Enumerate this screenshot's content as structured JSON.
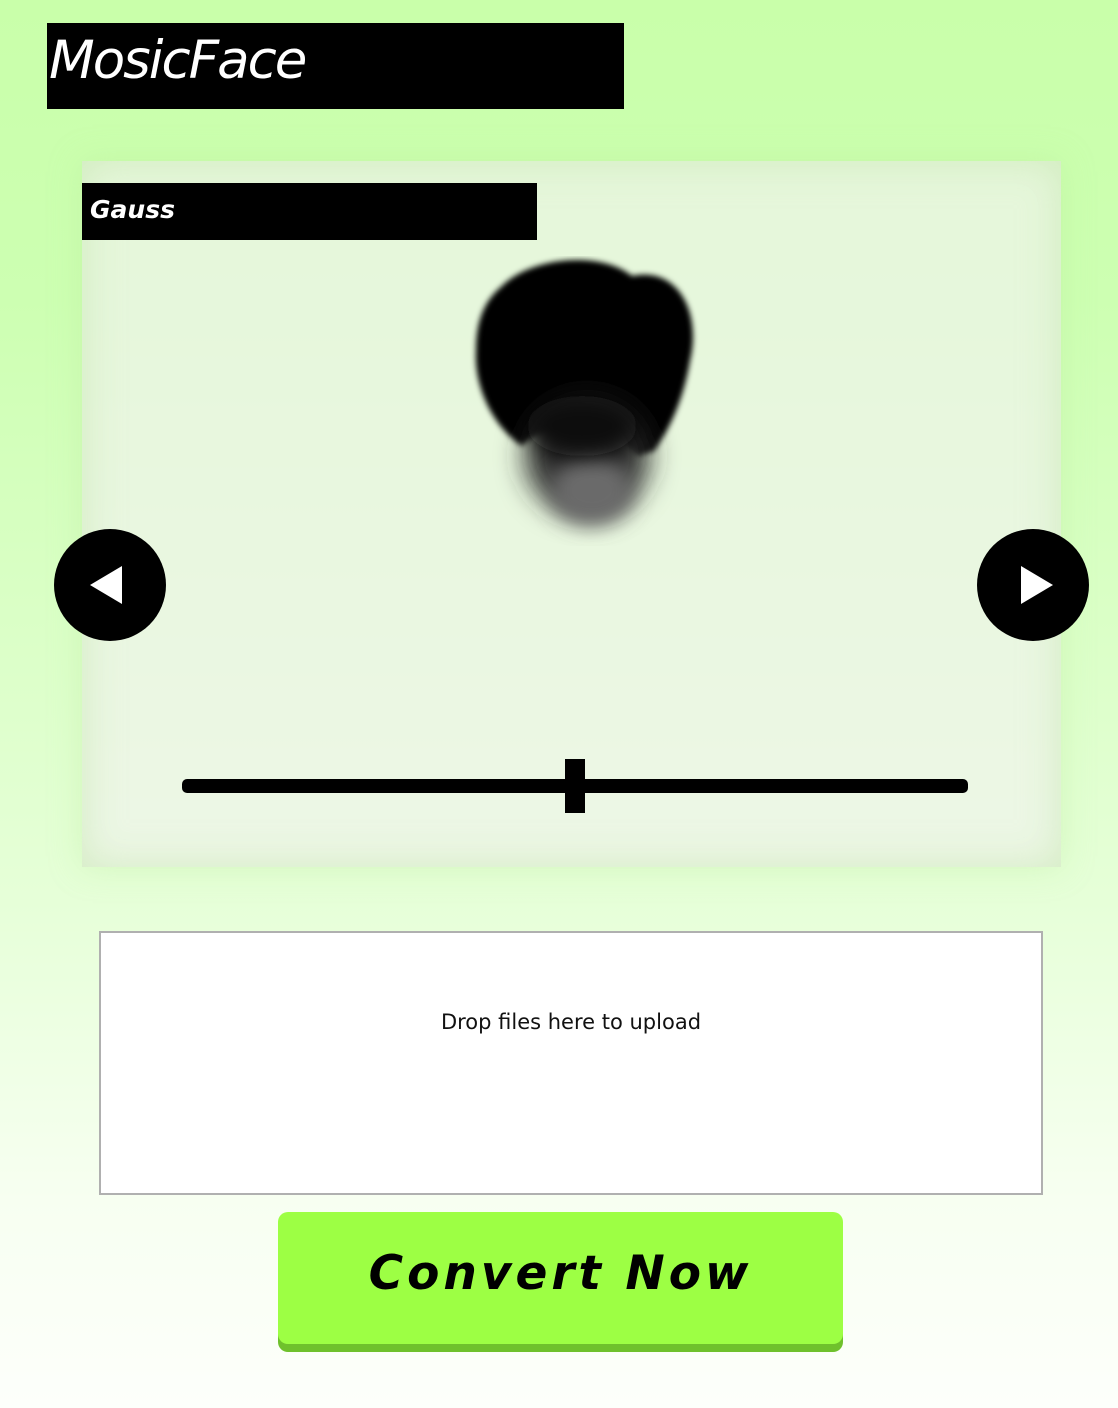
{
  "app": {
    "title": "MosicFace"
  },
  "preview": {
    "filter_name": "Gauss",
    "image_description_icon": "blurred-face-preview",
    "prev_icon": "triangle-left-icon",
    "next_icon": "triangle-right-icon"
  },
  "slider": {
    "value_fraction": 0.5
  },
  "upload": {
    "prompt": "Drop files here to upload"
  },
  "actions": {
    "convert_label": "Convert Now"
  },
  "colors": {
    "background_top": "#c9ffaa",
    "background_bottom": "#fdfffb",
    "accent_button": "#9dff44",
    "button_shadow": "#6fc12c",
    "dark": "#000000"
  }
}
